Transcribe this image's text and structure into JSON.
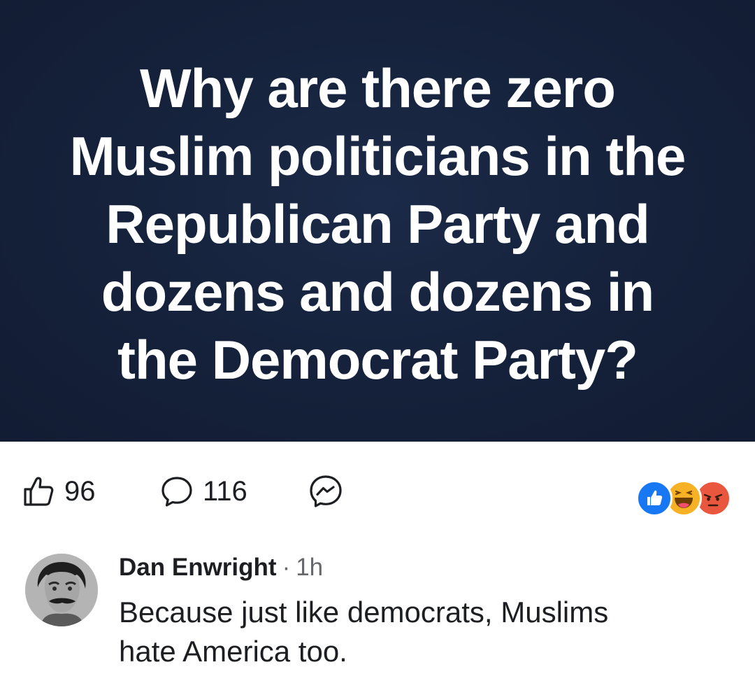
{
  "post": {
    "image_text_lines": [
      "Why are there zero",
      "Muslim politicians in the",
      "Republican Party and",
      "dozens and dozens in",
      "the Democrat Party?"
    ],
    "colors": {
      "image_background": "#16233d",
      "image_text": "#ffffff"
    }
  },
  "actions": {
    "like_icon": "thumbs-up-icon",
    "like_count": "96",
    "comment_icon": "comment-bubble-icon",
    "comment_count": "116",
    "share_icon": "messenger-icon"
  },
  "reactions": [
    {
      "type": "like",
      "icon": "like-reaction-icon",
      "color": "#1877f2"
    },
    {
      "type": "haha",
      "icon": "haha-reaction-icon",
      "color": "#f7b125"
    },
    {
      "type": "angry",
      "icon": "angry-reaction-icon",
      "color": "#e9573f"
    }
  ],
  "comment": {
    "author": "Dan Enwright",
    "separator": "·",
    "time": "1h",
    "text_lines": [
      "Because just like democrats, Muslims",
      "hate America too."
    ]
  }
}
